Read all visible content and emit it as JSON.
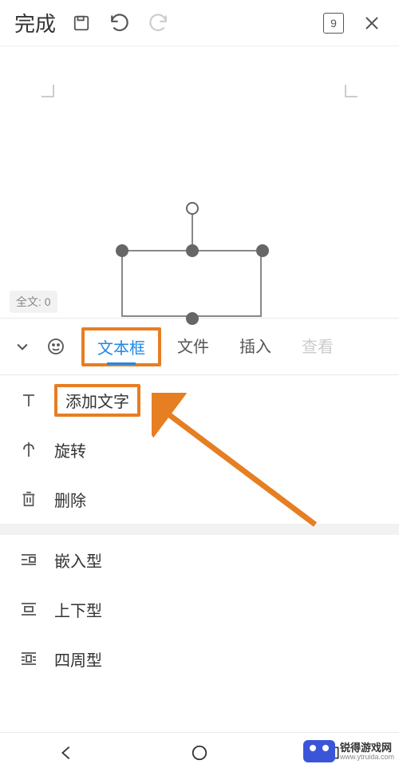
{
  "toolbar": {
    "done": "完成",
    "page_number": "9"
  },
  "canvas": {
    "word_count_label": "全文: 0"
  },
  "tabs": {
    "items": [
      "文本框",
      "文件",
      "插入",
      "查看"
    ],
    "active_index": 0
  },
  "actions": {
    "add_text": "添加文字",
    "rotate": "旋转",
    "delete": "删除"
  },
  "wrap_modes": {
    "inline": "嵌入型",
    "top_bottom": "上下型",
    "square": "四周型"
  },
  "watermark": {
    "brand": "锐得游戏网",
    "url": "www.ytruida.com"
  }
}
